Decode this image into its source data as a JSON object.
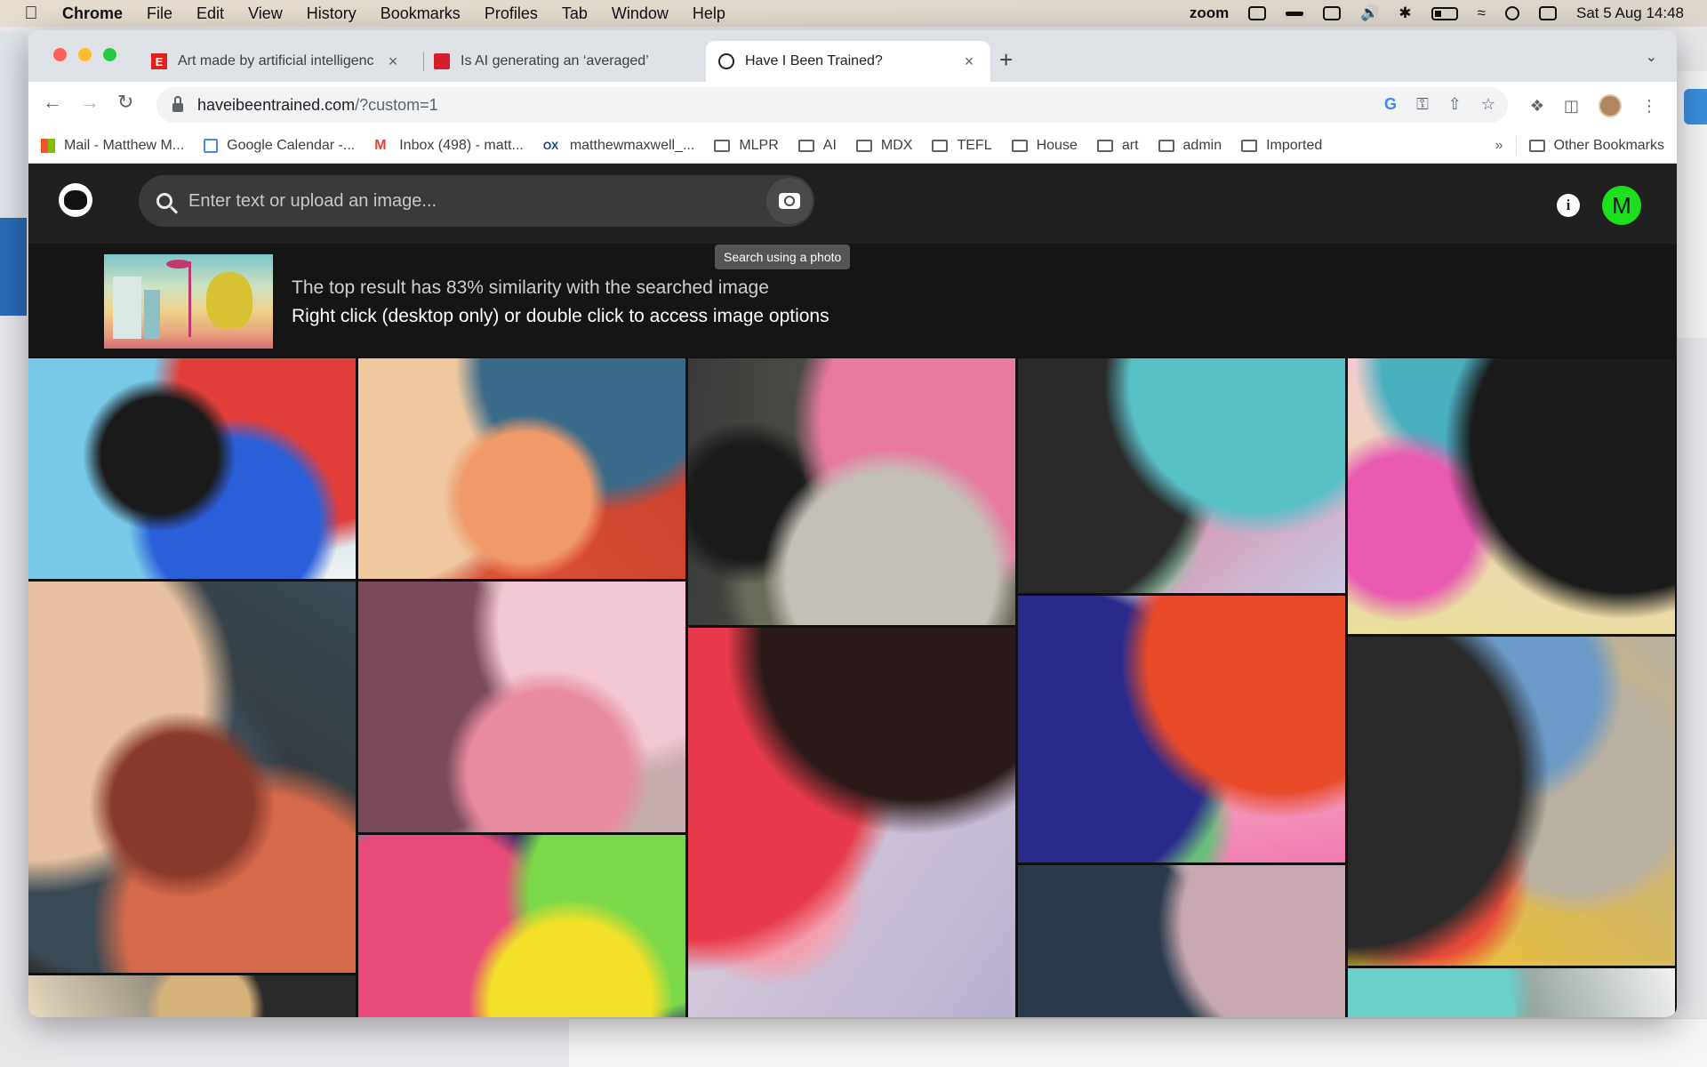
{
  "menubar": {
    "app": "Chrome",
    "items": [
      "File",
      "Edit",
      "View",
      "History",
      "Bookmarks",
      "Profiles",
      "Tab",
      "Window",
      "Help"
    ],
    "zoom_label": "zoom",
    "datetime": "Sat 5 Aug  14:48"
  },
  "tabs": [
    {
      "title": "Art made by artificial intelligenc",
      "favicon": "E",
      "color": "#e0201b"
    },
    {
      "title": "Is AI generating an ‘averaged’",
      "favicon": "",
      "color": "#d51e2b"
    },
    {
      "title": "Have I Been Trained?",
      "favicon": "",
      "color": "#000000"
    }
  ],
  "address": {
    "host": "haveibeentrained.com",
    "path": "/?custom=1"
  },
  "bookmarks": [
    {
      "label": "Mail - Matthew M...",
      "icon": "microsoft-icon"
    },
    {
      "label": "Google Calendar -...",
      "icon": "calendar-icon"
    },
    {
      "label": "Inbox (498) - matt...",
      "icon": "gmail-icon"
    },
    {
      "label": "matthewmaxwell_...",
      "icon": "ox-icon"
    },
    {
      "label": "MLPR",
      "icon": "folder-icon"
    },
    {
      "label": "AI",
      "icon": "folder-icon"
    },
    {
      "label": "MDX",
      "icon": "folder-icon"
    },
    {
      "label": "TEFL",
      "icon": "folder-icon"
    },
    {
      "label": "House",
      "icon": "folder-icon"
    },
    {
      "label": "art",
      "icon": "folder-icon"
    },
    {
      "label": "admin",
      "icon": "folder-icon"
    },
    {
      "label": "Imported",
      "icon": "folder-icon"
    }
  ],
  "bookmarks_more": "»",
  "other_bookmarks": "Other Bookmarks",
  "site": {
    "search_placeholder": "Enter text or upload an image...",
    "tooltip": "Search using a photo",
    "info_icon": "i",
    "user_initial": "M",
    "user_color": "#1de01d",
    "result_line1": "The top result has 83% similarity with the searched image",
    "result_line2": "Right click (desktop only) or double click to access image options"
  },
  "gallery_columns": [
    [
      {
        "h": 248,
        "colors": [
          "#f2f2f2",
          "#1a1a1a",
          "#2b5fd9",
          "#e23f3a",
          "#78c8e8"
        ]
      },
      {
        "h": 440,
        "colors": [
          "#2b2520",
          "#8a3a2a",
          "#d46a4a",
          "#e8c2a0",
          "#3a4a55"
        ]
      },
      {
        "h": 53,
        "colors": [
          "#e8dcc0",
          "#d5b27a",
          "#2a2a2a"
        ]
      }
    ],
    [
      {
        "h": 248,
        "colors": [
          "#e85a3a",
          "#f09a6a",
          "#3a6a8a",
          "#f0c8a0",
          "#c23a2a"
        ]
      },
      {
        "h": 282,
        "colors": [
          "#b8b49a",
          "#e88aa0",
          "#f2c6d2",
          "#7a4a5a",
          "#c8a9b0"
        ]
      },
      {
        "h": 211,
        "colors": [
          "#2a9ad8",
          "#f2e02a",
          "#7ad84a",
          "#e84a7a",
          "#2a2a6a"
        ]
      }
    ],
    [
      {
        "h": 300,
        "colors": [
          "#3a3a3a",
          "#c4c0b8",
          "#e87aa0",
          "#1a1a1a",
          "#6a6a5a"
        ]
      },
      {
        "h": 441,
        "colors": [
          "#e8d8e0",
          "#2a1a1a",
          "#e83a4a",
          "#f2a0b0",
          "#b8b0d0"
        ]
      }
    ],
    [
      {
        "h": 264,
        "colors": [
          "#e85a7a",
          "#5ac0c8",
          "#2a2a2a",
          "#8ac0a0",
          "#c8c8e0"
        ]
      },
      {
        "h": 300,
        "colors": [
          "#f2f2e0",
          "#e84a2a",
          "#2a2a8a",
          "#6ac07a",
          "#f27ab0"
        ]
      },
      {
        "h": 177,
        "colors": [
          "#1a1a1a",
          "#c8a8b0",
          "#2a3a4a",
          "#f2f2f2",
          "#6a6a6a"
        ]
      }
    ],
    [
      {
        "h": 310,
        "colors": [
          "#e8e09a",
          "#1a1a1a",
          "#e85ab0",
          "#4ab0c0",
          "#f2c8d8"
        ]
      },
      {
        "h": 370,
        "colors": [
          "#f2c02a",
          "#2a2a2a",
          "#e84a3a",
          "#6a9ac8",
          "#b8b0a0"
        ]
      },
      {
        "h": 61,
        "colors": [
          "#2a4a3a",
          "#6ad0c8",
          "#f2f2f2"
        ]
      }
    ]
  ]
}
